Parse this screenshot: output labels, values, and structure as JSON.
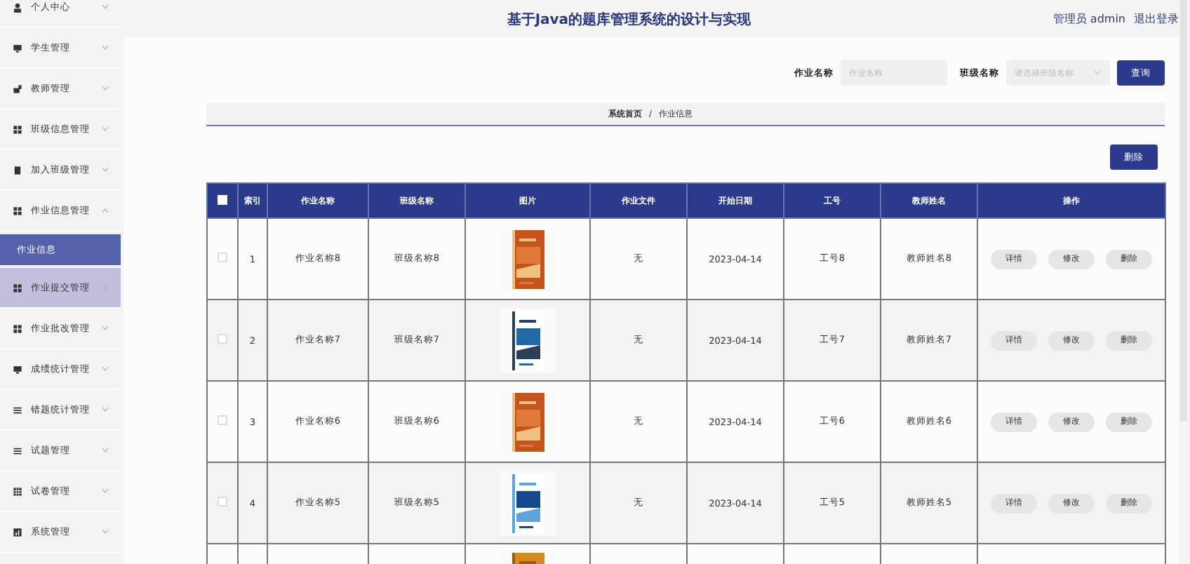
{
  "header": {
    "title": "基于Java的题库管理系统的设计与实现",
    "user": "管理员 admin",
    "logout": "退出登录"
  },
  "sidebar": [
    {
      "label": "个人中心",
      "kind": "person",
      "expanded": false,
      "hover": false
    },
    {
      "label": "学生管理",
      "kind": "monitor",
      "expanded": false,
      "hover": false
    },
    {
      "label": "教师管理",
      "kind": "teacher",
      "expanded": false,
      "hover": false
    },
    {
      "label": "班级信息管理",
      "kind": "grid",
      "expanded": false,
      "hover": false
    },
    {
      "label": "加入班级管理",
      "kind": "doc",
      "expanded": false,
      "hover": false
    },
    {
      "label": "作业信息管理",
      "kind": "grid",
      "expanded": true,
      "hover": false,
      "children": [
        {
          "label": "作业信息",
          "selected": true
        }
      ]
    },
    {
      "label": "作业提交管理",
      "kind": "grid",
      "expanded": false,
      "hover": true
    },
    {
      "label": "作业批改管理",
      "kind": "grid",
      "expanded": false,
      "hover": false
    },
    {
      "label": "成绩统计管理",
      "kind": "monitor",
      "expanded": false,
      "hover": false
    },
    {
      "label": "错题统计管理",
      "kind": "list",
      "expanded": false,
      "hover": false
    },
    {
      "label": "试题管理",
      "kind": "list",
      "expanded": false,
      "hover": false
    },
    {
      "label": "试卷管理",
      "kind": "table",
      "expanded": false,
      "hover": false
    },
    {
      "label": "系统管理",
      "kind": "chart",
      "expanded": false,
      "hover": false
    }
  ],
  "search": {
    "fields": [
      {
        "label": "作业名称",
        "kind": "input",
        "placeholder": "作业名称"
      },
      {
        "label": "班级名称",
        "kind": "select",
        "placeholder": "请选择班级名称"
      }
    ],
    "button": "查询"
  },
  "breadcrumb": [
    "系统首页",
    "/",
    "作业信息"
  ],
  "toolbar": {
    "delete": "删除"
  },
  "table": {
    "all_checked": false,
    "columns": [
      "索引",
      "作业名称",
      "班级名称",
      "图片",
      "作业文件",
      "开始日期",
      "工号",
      "教师姓名",
      "操作"
    ],
    "rows": [
      {
        "checked": false,
        "cells": [
          "1",
          "作业名称8",
          "班级名称8"
        ],
        "picture": {
          "kind": "picture"
        },
        "file": "无",
        "cells2": [
          "2023-04-14",
          "工号8",
          "教师姓名8"
        ],
        "actions": [
          "详情",
          "修改",
          "删除"
        ]
      },
      {
        "checked": false,
        "cells": [
          "2",
          "作业名称7",
          "班级名称7"
        ],
        "picture": {
          "kind": "picture"
        },
        "file": "无",
        "cells2": [
          "2023-04-14",
          "工号7",
          "教师姓名7"
        ],
        "actions": [
          "详情",
          "修改",
          "删除"
        ]
      },
      {
        "checked": false,
        "cells": [
          "3",
          "作业名称6",
          "班级名称6"
        ],
        "picture": {
          "kind": "picture"
        },
        "file": "无",
        "cells2": [
          "2023-04-14",
          "工号6",
          "教师姓名6"
        ],
        "actions": [
          "详情",
          "修改",
          "删除"
        ]
      },
      {
        "checked": false,
        "cells": [
          "4",
          "作业名称5",
          "班级名称5"
        ],
        "picture": {
          "kind": "picture"
        },
        "file": "无",
        "cells2": [
          "2023-04-14",
          "工号5",
          "教师姓名5"
        ],
        "actions": [
          "详情",
          "修改",
          "删除"
        ]
      },
      {
        "picture": {
          "kind": "picture"
        }
      }
    ]
  }
}
